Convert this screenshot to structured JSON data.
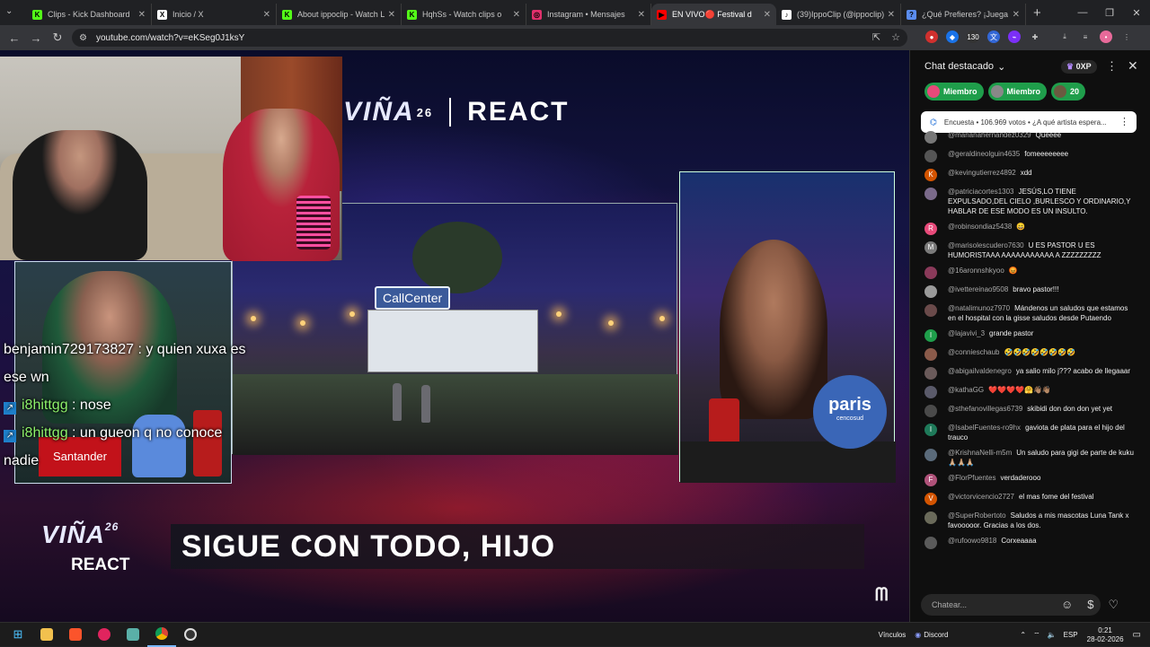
{
  "browser": {
    "tabs": [
      {
        "label": "Clips - Kick Dashboard",
        "favicon_color": "#53fc18",
        "favicon_char": "K"
      },
      {
        "label": "Inicio / X",
        "favicon_color": "#ffffff",
        "favicon_char": "X"
      },
      {
        "label": "About ippoclip - Watch Li",
        "favicon_color": "#53fc18",
        "favicon_char": "K"
      },
      {
        "label": "HqhSs - Watch clips o",
        "favicon_color": "#53fc18",
        "favicon_char": "K"
      },
      {
        "label": "Instagram • Mensajes",
        "favicon_color": "#e1306c",
        "favicon_char": "◎"
      },
      {
        "label": "EN VIVO🔴 Festival d",
        "favicon_color": "#ff0000",
        "favicon_char": "▶"
      },
      {
        "label": "(39)IppoClip (@ippoclip) |",
        "favicon_color": "#ffffff",
        "favicon_char": "♪"
      },
      {
        "label": "¿Qué Prefieres? ¡Juega en",
        "favicon_color": "#5b8def",
        "favicon_char": "?"
      }
    ],
    "active_tab_index": 5,
    "url": "youtube.com/watch?v=eKSeg0J1ksY"
  },
  "video": {
    "top_logo_vina": "VIÑA",
    "top_logo_year": "26",
    "top_logo_react": "REACT",
    "stage_sign": "CallCenter",
    "paris_logo": "paris",
    "paris_sub": "cencosud",
    "santander": "Santander",
    "overlay_chat": [
      {
        "kick": false,
        "text": "benjamin729173827 : y quien xuxa es ese wn"
      },
      {
        "kick": true,
        "user": "i8hittgg",
        "text": " : nose"
      },
      {
        "kick": true,
        "user": "i8hittgg",
        "text": " : un gueon q no conoce nadie"
      }
    ],
    "lower_vina": "VIÑA",
    "lower_year": "26",
    "lower_react": "REACT",
    "banner": "SIGUE CON TODO, HIJO"
  },
  "chat": {
    "title": "Chat destacado",
    "xp": "0XP",
    "pills": [
      {
        "label": "Miembro",
        "avatar_color": "#e84a7a"
      },
      {
        "label": "Miembro",
        "avatar_color": "#888888"
      },
      {
        "label": "20",
        "avatar_color": "#6a5a40"
      }
    ],
    "poll": "Encuesta • 106.969 votos • ¿A qué artista espera...",
    "messages": [
      {
        "user": "@marianahernandez0329",
        "text": "Queeee",
        "color": "#777777",
        "letter": ""
      },
      {
        "user": "@geraldineolguin4635",
        "text": "fomeeeeeeee",
        "color": "#555555",
        "letter": ""
      },
      {
        "user": "@kevingutierrez4892",
        "text": "xdd",
        "color": "#d35400",
        "letter": "K"
      },
      {
        "user": "@patriciacortes1303",
        "text": "JESÚS,LO TIENE EXPULSADO,DEL CIELO ,BURLESCO Y ORDINARIO,Y HABLAR DE ESE MODO ES UN INSULTO.",
        "color": "#7a6a8a",
        "letter": ""
      },
      {
        "user": "@robinsondiaz5438",
        "text": "😄",
        "color": "#e84a7a",
        "letter": "R"
      },
      {
        "user": "@marisolescudero7630",
        "text": "U ES PASTOR U ES HUMORISTAAA AAAAAAAAAAA A ZZZZZZZZZ",
        "color": "#7a7a7a",
        "letter": "M"
      },
      {
        "user": "@16aronnshkyoo",
        "text": "😡",
        "color": "#8a3a5a",
        "letter": ""
      },
      {
        "user": "@ivettereinao9508",
        "text": "bravo pastor!!!",
        "color": "#9a9a9a",
        "letter": ""
      },
      {
        "user": "@natalimunoz7970",
        "text": "Mándenos un saludos que estamos en el hospital con la gisse saludos desde Putaendo",
        "color": "#6a4a4a",
        "letter": ""
      },
      {
        "user": "@lajavivi_3",
        "text": "grande pastor",
        "color": "#1f9e4b",
        "letter": "l"
      },
      {
        "user": "@connieschaub",
        "text": "🤣🤣🤣🤣🤣🤣🤣🤣",
        "color": "#8a5a4a",
        "letter": ""
      },
      {
        "user": "@abigailvaldenegro",
        "text": "ya salio milo j??? acabo de llegaaar",
        "color": "#6a5a5a",
        "letter": ""
      },
      {
        "user": "@kathaGG",
        "text": "❤️❤️❤️❤️🤗👋🏽👋🏽",
        "color": "#5a5a6a",
        "letter": ""
      },
      {
        "user": "@sthefanovillegas6739",
        "text": "skibidi don don don yet yet",
        "color": "#4a4a4a",
        "letter": ""
      },
      {
        "user": "@IsabelFuentes-ro9hx",
        "text": "gaviota de plata para el hijo del trauco",
        "color": "#1f7a5a",
        "letter": "I"
      },
      {
        "user": "@KrishnaNelli-m5m",
        "text": "Un saludo para gigi de parte de kuku 🙏🏼🙏🏼🙏🏼",
        "color": "#5a6a7a",
        "letter": ""
      },
      {
        "user": "@FlorPfuentes",
        "text": "verdaderooo",
        "color": "#b0527a",
        "letter": "F"
      },
      {
        "user": "@victorvicencio2727",
        "text": "el mas fome del festival",
        "color": "#d35400",
        "letter": "V"
      },
      {
        "user": "@SuperRobertoto",
        "text": "Saludos a mis mascotas Luna Tank x favooooor. Gracias a los dos.",
        "color": "#6a6a5a",
        "letter": ""
      },
      {
        "user": "@rufoowo9818",
        "text": "Corxeaaaa",
        "color": "#5a5a5a",
        "letter": ""
      }
    ],
    "input_placeholder": "Chatear..."
  },
  "taskbar": {
    "links_label": "Vínculos",
    "discord_label": "Discord",
    "lang": "ESP",
    "time": "0:21",
    "date": "28-02-2026"
  }
}
